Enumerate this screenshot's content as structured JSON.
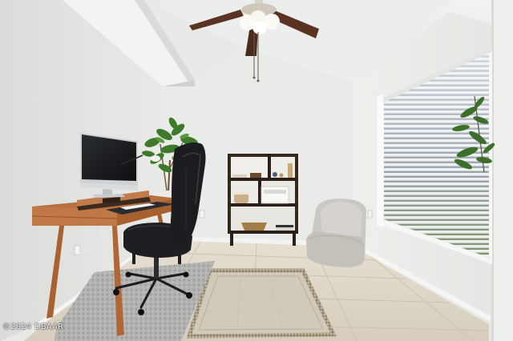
{
  "photo": {
    "watermark": "©2024 DBAAR"
  },
  "palette": {
    "wall": "#e7e8e5",
    "ceiling": "#eef0ef",
    "tile": "#ddd6c8",
    "desk_wood": "#b86f3e",
    "chair": "#1d1f22",
    "shelf": "#3a2c22",
    "armchair": "#cfccc6",
    "foliage": "#3f7d2e"
  }
}
